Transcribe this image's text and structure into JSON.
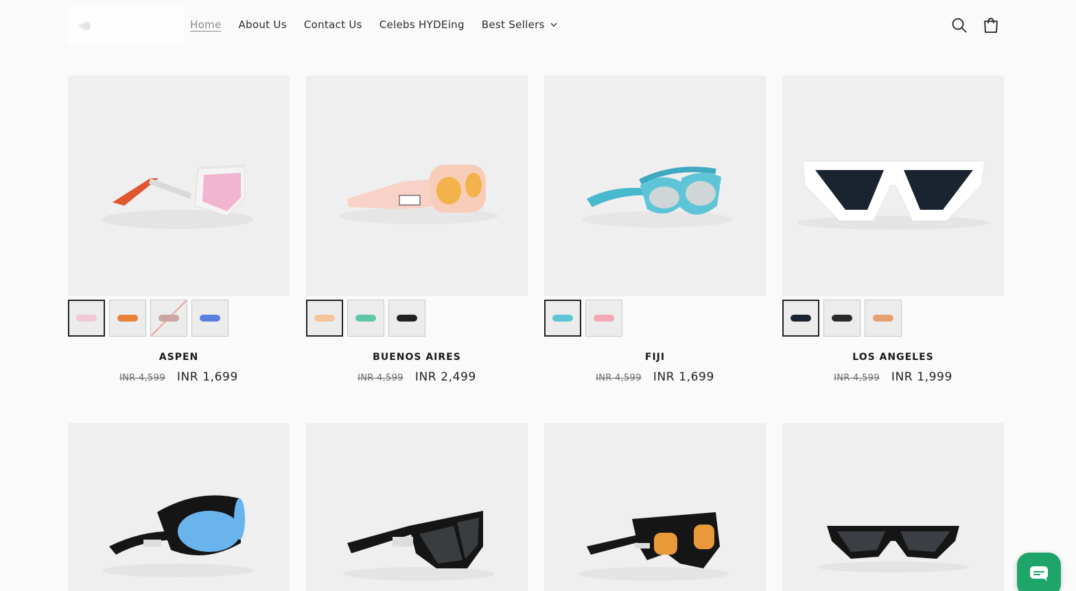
{
  "header": {
    "nav": [
      {
        "label": "Home",
        "active": true
      },
      {
        "label": "About Us"
      },
      {
        "label": "Contact Us"
      },
      {
        "label": "Celebs HYDEing"
      },
      {
        "label": "Best Sellers",
        "dropdown": true
      }
    ],
    "icons": {
      "search": "search-icon",
      "cart": "cart-icon",
      "dropdown": "chevron-down-icon"
    }
  },
  "products": [
    {
      "name": "ASPEN",
      "old_price": "INR 4,599",
      "price": "INR 1,699"
    },
    {
      "name": "BUENOS AIRES",
      "old_price": "INR 4,599",
      "price": "INR 2,499"
    },
    {
      "name": "FIJI",
      "old_price": "INR 4,599",
      "price": "INR 1,699"
    },
    {
      "name": "LOS ANGELES",
      "old_price": "INR 4,599",
      "price": "INR 1,999"
    }
  ],
  "product_swatches": [
    [
      "#f0c8d8",
      "#e8803a",
      "#c9a6a0",
      "#5b7fe0"
    ],
    [
      "#f5c49a",
      "#5fc7a7",
      "#222222"
    ],
    [
      "#5ec5d8",
      "#f3a8b6"
    ],
    [
      "#1a2330",
      "#2a2a2a",
      "#e9a070"
    ]
  ],
  "row2_products": [
    {
      "lens_color": "#6ab4ee",
      "frame_color": "#151515"
    },
    {
      "lens_color": "#3a3d40",
      "frame_color": "#151515"
    },
    {
      "lens_color": "#e89a3a",
      "frame_color": "#151515"
    },
    {
      "lens_color": "#3b3e42",
      "frame_color": "#151515"
    }
  ],
  "colors": {
    "accent_chat": "#1fa46a",
    "text": "#1a1a1a",
    "strikethrough": "#6b6b6b"
  }
}
